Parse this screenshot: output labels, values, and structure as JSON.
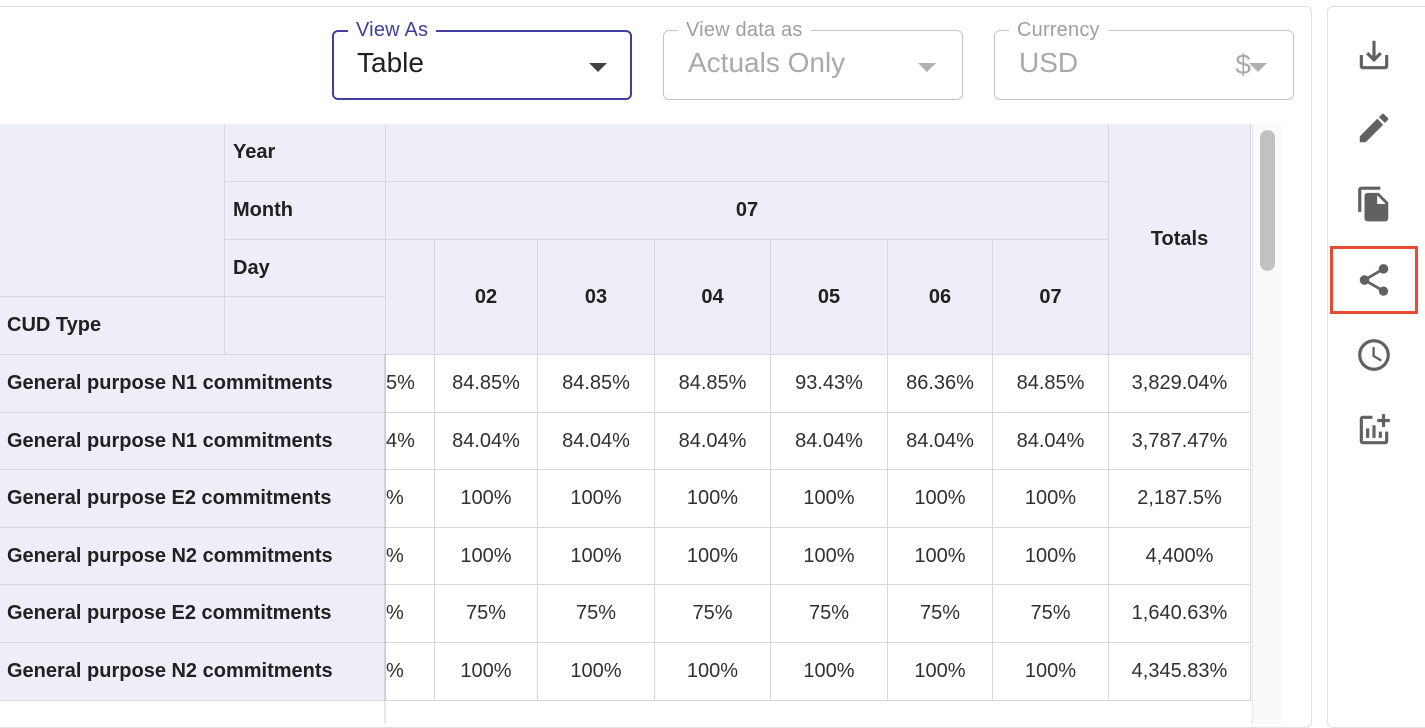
{
  "controls": {
    "view_as": {
      "label": "View As",
      "value": "Table"
    },
    "view_data_as": {
      "label": "View data as",
      "value": "Actuals Only"
    },
    "currency": {
      "label": "Currency",
      "value": "USD",
      "symbol": "$"
    }
  },
  "table": {
    "header_labels": {
      "year": "Year",
      "month": "Month",
      "day": "Day",
      "cud_type": "CUD Type",
      "totals": "Totals"
    },
    "month_value": "07",
    "days": [
      "02",
      "03",
      "04",
      "05",
      "06",
      "07"
    ],
    "rows": [
      {
        "label": "General purpose N1 commitments",
        "clipped": "5%",
        "values": [
          "84.85%",
          "84.85%",
          "84.85%",
          "93.43%",
          "86.36%",
          "84.85%"
        ],
        "total": "3,829.04%"
      },
      {
        "label": "General purpose N1 commitments",
        "clipped": "4%",
        "values": [
          "84.04%",
          "84.04%",
          "84.04%",
          "84.04%",
          "84.04%",
          "84.04%"
        ],
        "total": "3,787.47%"
      },
      {
        "label": "General purpose E2 commitments",
        "clipped": "%",
        "values": [
          "100%",
          "100%",
          "100%",
          "100%",
          "100%",
          "100%"
        ],
        "total": "2,187.5%"
      },
      {
        "label": "General purpose N2 commitments",
        "clipped": "%",
        "values": [
          "100%",
          "100%",
          "100%",
          "100%",
          "100%",
          "100%"
        ],
        "total": "4,400%"
      },
      {
        "label": "General purpose E2 commitments",
        "clipped": "%",
        "values": [
          "75%",
          "75%",
          "75%",
          "75%",
          "75%",
          "75%"
        ],
        "total": "1,640.63%"
      },
      {
        "label": "General purpose N2 commitments",
        "clipped": "%",
        "values": [
          "100%",
          "100%",
          "100%",
          "100%",
          "100%",
          "100%"
        ],
        "total": "4,345.83%"
      }
    ]
  },
  "toolbar": {
    "icons": [
      "download-icon",
      "edit-icon",
      "copy-icon",
      "share-icon",
      "history-icon",
      "add-chart-icon"
    ],
    "highlighted": "share-icon",
    "highlight_color": "#e84a33",
    "accent_color": "#3f3f9d"
  }
}
